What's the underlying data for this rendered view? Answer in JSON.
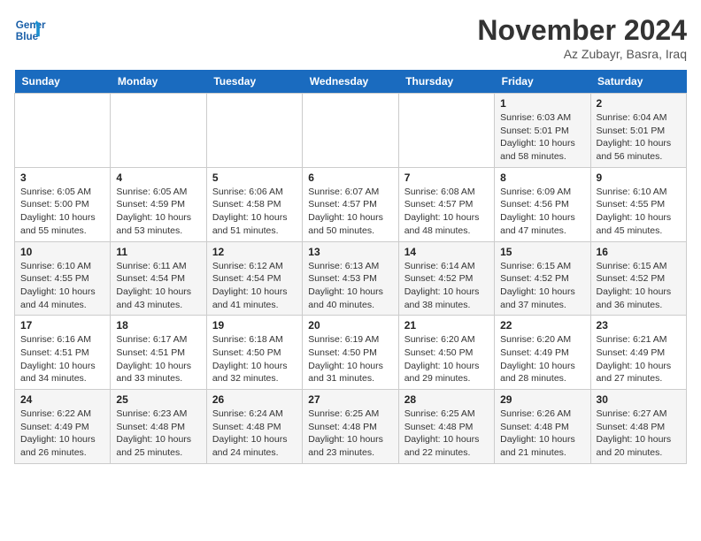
{
  "logo": {
    "text_line1": "General",
    "text_line2": "Blue"
  },
  "header": {
    "month_year": "November 2024",
    "location": "Az Zubayr, Basra, Iraq"
  },
  "weekdays": [
    "Sunday",
    "Monday",
    "Tuesday",
    "Wednesday",
    "Thursday",
    "Friday",
    "Saturday"
  ],
  "weeks": [
    [
      {
        "day": "",
        "info": ""
      },
      {
        "day": "",
        "info": ""
      },
      {
        "day": "",
        "info": ""
      },
      {
        "day": "",
        "info": ""
      },
      {
        "day": "",
        "info": ""
      },
      {
        "day": "1",
        "info": "Sunrise: 6:03 AM\nSunset: 5:01 PM\nDaylight: 10 hours\nand 58 minutes."
      },
      {
        "day": "2",
        "info": "Sunrise: 6:04 AM\nSunset: 5:01 PM\nDaylight: 10 hours\nand 56 minutes."
      }
    ],
    [
      {
        "day": "3",
        "info": "Sunrise: 6:05 AM\nSunset: 5:00 PM\nDaylight: 10 hours\nand 55 minutes."
      },
      {
        "day": "4",
        "info": "Sunrise: 6:05 AM\nSunset: 4:59 PM\nDaylight: 10 hours\nand 53 minutes."
      },
      {
        "day": "5",
        "info": "Sunrise: 6:06 AM\nSunset: 4:58 PM\nDaylight: 10 hours\nand 51 minutes."
      },
      {
        "day": "6",
        "info": "Sunrise: 6:07 AM\nSunset: 4:57 PM\nDaylight: 10 hours\nand 50 minutes."
      },
      {
        "day": "7",
        "info": "Sunrise: 6:08 AM\nSunset: 4:57 PM\nDaylight: 10 hours\nand 48 minutes."
      },
      {
        "day": "8",
        "info": "Sunrise: 6:09 AM\nSunset: 4:56 PM\nDaylight: 10 hours\nand 47 minutes."
      },
      {
        "day": "9",
        "info": "Sunrise: 6:10 AM\nSunset: 4:55 PM\nDaylight: 10 hours\nand 45 minutes."
      }
    ],
    [
      {
        "day": "10",
        "info": "Sunrise: 6:10 AM\nSunset: 4:55 PM\nDaylight: 10 hours\nand 44 minutes."
      },
      {
        "day": "11",
        "info": "Sunrise: 6:11 AM\nSunset: 4:54 PM\nDaylight: 10 hours\nand 43 minutes."
      },
      {
        "day": "12",
        "info": "Sunrise: 6:12 AM\nSunset: 4:54 PM\nDaylight: 10 hours\nand 41 minutes."
      },
      {
        "day": "13",
        "info": "Sunrise: 6:13 AM\nSunset: 4:53 PM\nDaylight: 10 hours\nand 40 minutes."
      },
      {
        "day": "14",
        "info": "Sunrise: 6:14 AM\nSunset: 4:52 PM\nDaylight: 10 hours\nand 38 minutes."
      },
      {
        "day": "15",
        "info": "Sunrise: 6:15 AM\nSunset: 4:52 PM\nDaylight: 10 hours\nand 37 minutes."
      },
      {
        "day": "16",
        "info": "Sunrise: 6:15 AM\nSunset: 4:52 PM\nDaylight: 10 hours\nand 36 minutes."
      }
    ],
    [
      {
        "day": "17",
        "info": "Sunrise: 6:16 AM\nSunset: 4:51 PM\nDaylight: 10 hours\nand 34 minutes."
      },
      {
        "day": "18",
        "info": "Sunrise: 6:17 AM\nSunset: 4:51 PM\nDaylight: 10 hours\nand 33 minutes."
      },
      {
        "day": "19",
        "info": "Sunrise: 6:18 AM\nSunset: 4:50 PM\nDaylight: 10 hours\nand 32 minutes."
      },
      {
        "day": "20",
        "info": "Sunrise: 6:19 AM\nSunset: 4:50 PM\nDaylight: 10 hours\nand 31 minutes."
      },
      {
        "day": "21",
        "info": "Sunrise: 6:20 AM\nSunset: 4:50 PM\nDaylight: 10 hours\nand 29 minutes."
      },
      {
        "day": "22",
        "info": "Sunrise: 6:20 AM\nSunset: 4:49 PM\nDaylight: 10 hours\nand 28 minutes."
      },
      {
        "day": "23",
        "info": "Sunrise: 6:21 AM\nSunset: 4:49 PM\nDaylight: 10 hours\nand 27 minutes."
      }
    ],
    [
      {
        "day": "24",
        "info": "Sunrise: 6:22 AM\nSunset: 4:49 PM\nDaylight: 10 hours\nand 26 minutes."
      },
      {
        "day": "25",
        "info": "Sunrise: 6:23 AM\nSunset: 4:48 PM\nDaylight: 10 hours\nand 25 minutes."
      },
      {
        "day": "26",
        "info": "Sunrise: 6:24 AM\nSunset: 4:48 PM\nDaylight: 10 hours\nand 24 minutes."
      },
      {
        "day": "27",
        "info": "Sunrise: 6:25 AM\nSunset: 4:48 PM\nDaylight: 10 hours\nand 23 minutes."
      },
      {
        "day": "28",
        "info": "Sunrise: 6:25 AM\nSunset: 4:48 PM\nDaylight: 10 hours\nand 22 minutes."
      },
      {
        "day": "29",
        "info": "Sunrise: 6:26 AM\nSunset: 4:48 PM\nDaylight: 10 hours\nand 21 minutes."
      },
      {
        "day": "30",
        "info": "Sunrise: 6:27 AM\nSunset: 4:48 PM\nDaylight: 10 hours\nand 20 minutes."
      }
    ]
  ]
}
